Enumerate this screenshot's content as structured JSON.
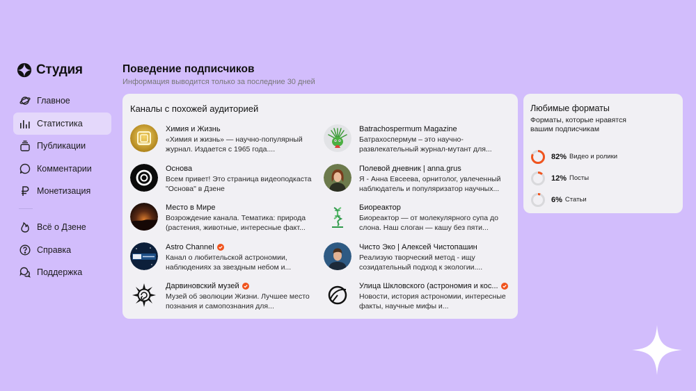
{
  "app": {
    "name": "Студия"
  },
  "sidebar": {
    "items": [
      {
        "label": "Главное",
        "icon": "planet-icon"
      },
      {
        "label": "Статистика",
        "icon": "chart-bars-icon",
        "active": true
      },
      {
        "label": "Публикации",
        "icon": "stack-icon"
      },
      {
        "label": "Комментарии",
        "icon": "comment-icon"
      },
      {
        "label": "Монетизация",
        "icon": "ruble-icon"
      }
    ],
    "secondary": [
      {
        "label": "Всё о Дзене",
        "icon": "fire-icon"
      },
      {
        "label": "Справка",
        "icon": "help-icon"
      },
      {
        "label": "Поддержка",
        "icon": "chat-bubbles-icon"
      }
    ]
  },
  "header": {
    "title": "Поведение подписчиков",
    "subtitle": "Информация выводится только за последние 30 дней"
  },
  "similar": {
    "title": "Каналы с похожей аудиторией",
    "channels": [
      {
        "name": "Химия и Жизнь",
        "desc": "«Химия и жизнь» — научно-популярный журнал. Издается с 1965 года....",
        "verified": false
      },
      {
        "name": "Batrachospermum Magazine",
        "desc": "Батрахоспермум – это научно-развлекательный журнал-мутант для...",
        "verified": false
      },
      {
        "name": "Основа",
        "desc": "Всем привет! Это страница видеоподкаста \"Основа\" в Дзене",
        "verified": false
      },
      {
        "name": "Полевой дневник | anna.grus",
        "desc": "Я - Анна Евсеева, орнитолог, увлеченный наблюдатель и популяризатор научных...",
        "verified": false
      },
      {
        "name": "Место в Мире",
        "desc": "Возрождение канала. Тематика: природа (растения, животные, интересные факт...",
        "verified": false
      },
      {
        "name": "Биореактор",
        "desc": "Биореактор — от молекулярного супа до слона. Наш слоган — кашу без пяти...",
        "verified": false
      },
      {
        "name": "Astro Channel",
        "desc": "Канал о любительской астрономии, наблюдениях за звездным небом и...",
        "verified": true
      },
      {
        "name": "Чисто Эко | Алексей Чистопашин",
        "desc": "Реализую творческий метод - ищу созидательный подход к экологии....",
        "verified": false
      },
      {
        "name": "Дарвиновский музей",
        "desc": "Музей об эволюции Жизни. Лучшее место познания и самопознания для...",
        "verified": true
      },
      {
        "name": "Улица Шкловского (астрономия и кос...",
        "desc": "Новости, история астрономии, интересные факты, научные мифы и...",
        "verified": true
      }
    ]
  },
  "formats": {
    "title": "Любимые форматы",
    "subtitle": "Форматы, которые нравятся вашим подписчикам",
    "items": [
      {
        "pct": "82%",
        "label": "Видео и ролики",
        "value": 0.82
      },
      {
        "pct": "12%",
        "label": "Посты",
        "value": 0.12
      },
      {
        "pct": "6%",
        "label": "Статьи",
        "value": 0.06
      }
    ]
  },
  "colors": {
    "background": "#d2bdfc",
    "accent": "#f0541e",
    "card": "#f1f0f4",
    "active_nav": "#e4d8fb"
  }
}
